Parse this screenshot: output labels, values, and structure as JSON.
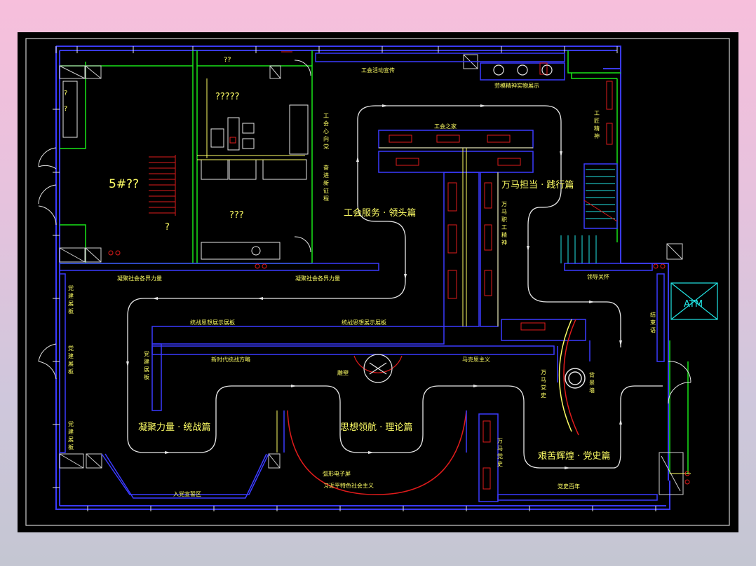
{
  "labels": {
    "top_small_room": "??",
    "reception": "?????",
    "room_5": "5#??",
    "room_5_mark": "?",
    "room_lower": "???",
    "side_mark_a": "?",
    "side_mark_b": "?",
    "union_activity_promo": "工会活动宣传",
    "labor_spirit_display": "劳模精神实物展示",
    "craftsman_spirit": "工匠精神",
    "union_home": "工会之家",
    "wanma_hall": "万马担当 · 践行篇",
    "service_hall": "工会服务 · 领头篇",
    "union_heart": "工会心向党",
    "new_journey": "奋进新征程",
    "staff_spirit": "万马职工精神",
    "unite_force_1": "凝聚社会各界力量",
    "unite_force_2": "凝聚社会各界力量",
    "leader_care": "领导关怀",
    "atm": "ATM",
    "ending_wall": "结束语",
    "party_board_1": "党建展板",
    "party_board_2": "党建展板",
    "party_board_3": "党建展板",
    "party_board_4": "党建展板",
    "united_front_1": "统战思想展示展板",
    "united_front_2": "统战思想展示展板",
    "new_era_strategy": "新时代统战方略",
    "sculpture": "雕塑",
    "marxism": "马克思主义",
    "wanma_party_history": "万马党史",
    "backdrop_wall": "背景墙",
    "unite_hall": "凝聚力量 · 统战篇",
    "thought_hall": "思想领航 · 理论篇",
    "party_history_hall": "艰苦辉煌 · 党史篇",
    "wanma_party_history_2": "万马党史",
    "party_century": "党史百年",
    "new_member_area": "入党宣誓区",
    "e_screen": "弧形电子屏",
    "socialism": "习近平特色社会主义"
  },
  "colors": {
    "wall_blue": "#3a3aff",
    "wall_green": "#19e619",
    "label_yellow": "#ffff66",
    "case_red": "#e01b1b",
    "route_white": "#e6e6e6",
    "atm_cyan": "#22e5e5"
  }
}
